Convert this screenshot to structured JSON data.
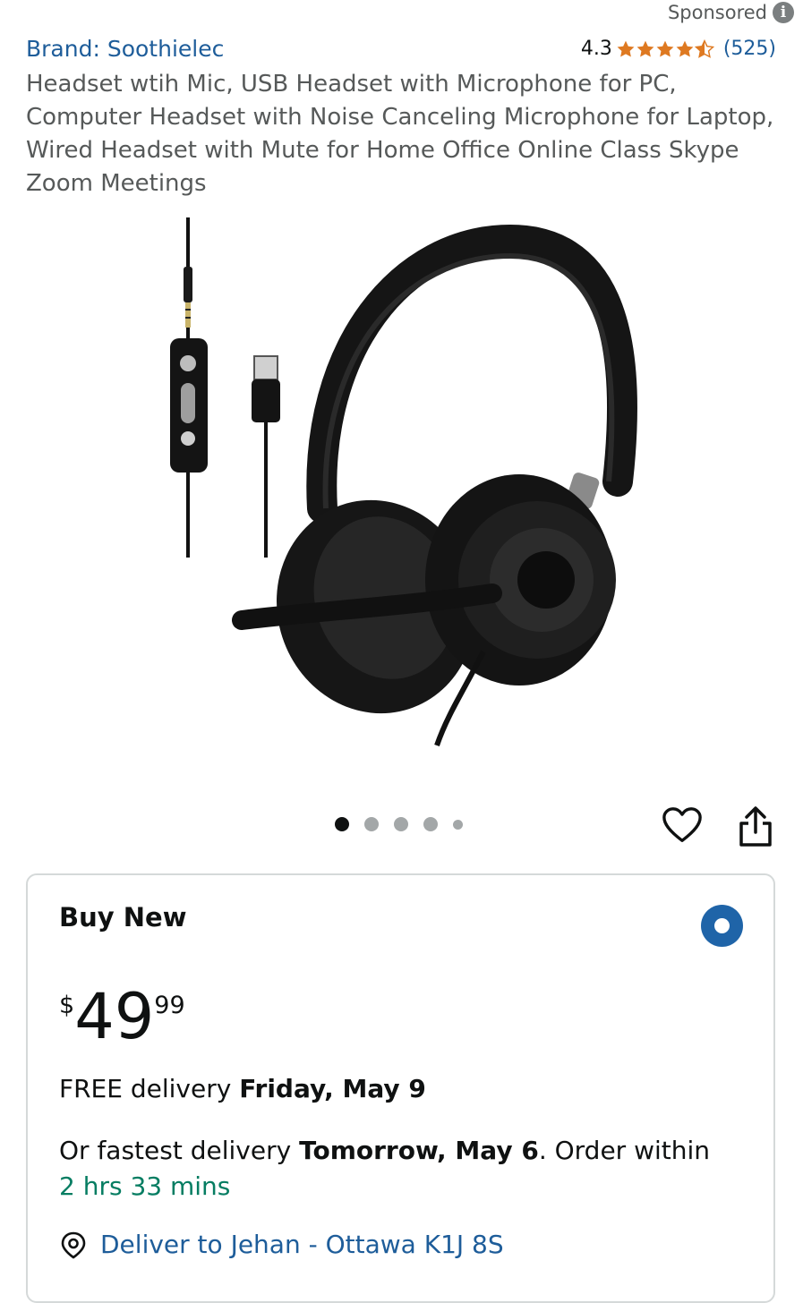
{
  "header": {
    "sponsored_label": "Sponsored",
    "info_icon": "i"
  },
  "product": {
    "brand": "Brand: Soothielec",
    "rating": {
      "value": "4.3",
      "stars": 4.3,
      "count": "(525)",
      "star_color": "#de7921"
    },
    "title": "Headset wtih Mic, USB Headset with Microphone for PC, Computer Headset with Noise Canceling Microphone for Laptop, Wired Headset with Mute for Home Office Online Class Skype Zoom Meetings"
  },
  "gallery": {
    "total_images": 5,
    "active_index": 0
  },
  "actions": {
    "wishlist_icon": "heart-icon",
    "share_icon": "share-icon"
  },
  "buy_box": {
    "title": "Buy New",
    "price": {
      "symbol": "$",
      "whole": "49",
      "fraction": "99"
    },
    "delivery": {
      "prefix": "FREE delivery ",
      "date": "Friday, May 9"
    },
    "fastest": {
      "prefix": "Or fastest delivery ",
      "date": "Tomorrow, May 6",
      "suffix": ". Order within",
      "countdown": "2 hrs 33 mins"
    },
    "deliver_to": "Deliver to Jehan - Ottawa K1J 8S",
    "radio_color": "#1f64a8"
  },
  "colors": {
    "link": "#1e5d9a",
    "countdown": "#067d62",
    "muted": "#565959"
  }
}
